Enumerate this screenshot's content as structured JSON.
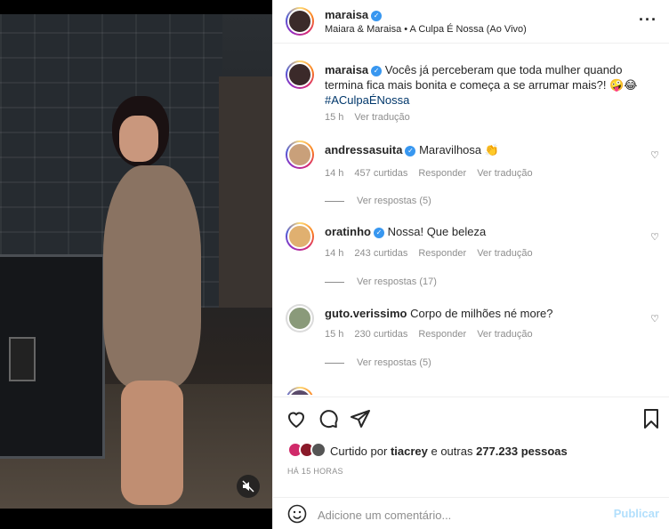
{
  "post": {
    "author": "maraisa",
    "audio": "Maiara & Maraisa • A Culpa É Nossa (Ao Vivo)",
    "more_icon": "more-icon",
    "mute_icon": "muted-speaker-icon"
  },
  "caption": {
    "author": "maraisa",
    "text": "Vocês já perceberam que toda mulher quando termina fica mais bonita e começa a se arrumar mais?! 🤪😂",
    "hashtag": "#ACulpaÉNossa",
    "time": "15 h",
    "translate": "Ver tradução"
  },
  "comments": [
    {
      "user": "andressasuita",
      "verified": true,
      "text": "Maravilhosa 👏",
      "time": "14 h",
      "likes": "457 curtidas",
      "reply": "Responder",
      "translate": "Ver tradução",
      "replies": "Ver respostas (5)"
    },
    {
      "user": "oratinho",
      "verified": true,
      "text": "Nossa! Que beleza",
      "time": "14 h",
      "likes": "243 curtidas",
      "reply": "Responder",
      "translate": "Ver tradução",
      "replies": "Ver respostas (17)"
    },
    {
      "user": "guto.verissimo",
      "verified": false,
      "text": "Corpo de milhões né more?",
      "time": "15 h",
      "likes": "230 curtidas",
      "reply": "Responder",
      "translate": "Ver tradução",
      "replies": "Ver respostas (5)"
    }
  ],
  "actions": {
    "like_icon": "heart-icon",
    "comment_icon": "comment-icon",
    "share_icon": "paper-plane-icon",
    "save_icon": "bookmark-icon"
  },
  "likes": {
    "prefix": "Curtido por",
    "user": "tiacrey",
    "suffix": "e outras",
    "count": "277.233",
    "unit": "pessoas"
  },
  "time_ago": "HÁ 15 HORAS",
  "add_comment": {
    "placeholder": "Adicione um comentário...",
    "post_label": "Publicar"
  },
  "colors": {
    "verified": "#3897f0",
    "link": "#00376b",
    "post_disabled": "#b2dffc",
    "meta": "#8e8e8e"
  }
}
